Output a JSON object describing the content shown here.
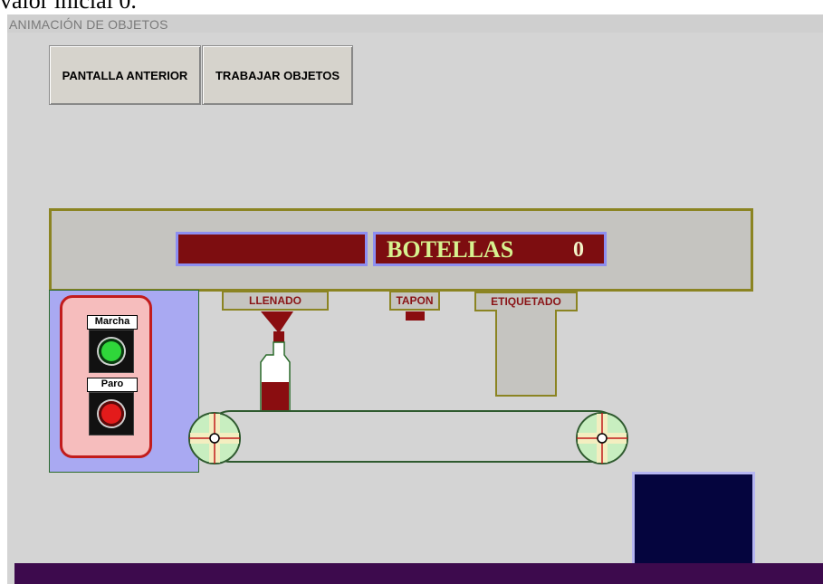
{
  "page_top_fragment": "valor inicial 0.",
  "window": {
    "title": "ANIMACIÓN DE OBJETOS"
  },
  "toolbar": {
    "prev_screen_label": "PANTALLA ANTERIOR",
    "work_objects_label": "TRABAJAR OBJETOS"
  },
  "display": {
    "counter_label": "BOTELLAS",
    "counter_value": "0",
    "status_color": "#7d0d10"
  },
  "stations": {
    "filling": "LLENADO",
    "cap": "TAPON",
    "labeling": "ETIQUETADO"
  },
  "controls": {
    "start_label": "Marcha",
    "stop_label": "Paro",
    "start_color": "#2fd63a",
    "stop_color": "#e31b1b"
  },
  "colors": {
    "background": "#d4d4d4",
    "panel_border": "#8b8422",
    "display_border": "#8d8ef0",
    "bottom_bar": "#3d0a4d",
    "output_box": "#05053e"
  }
}
